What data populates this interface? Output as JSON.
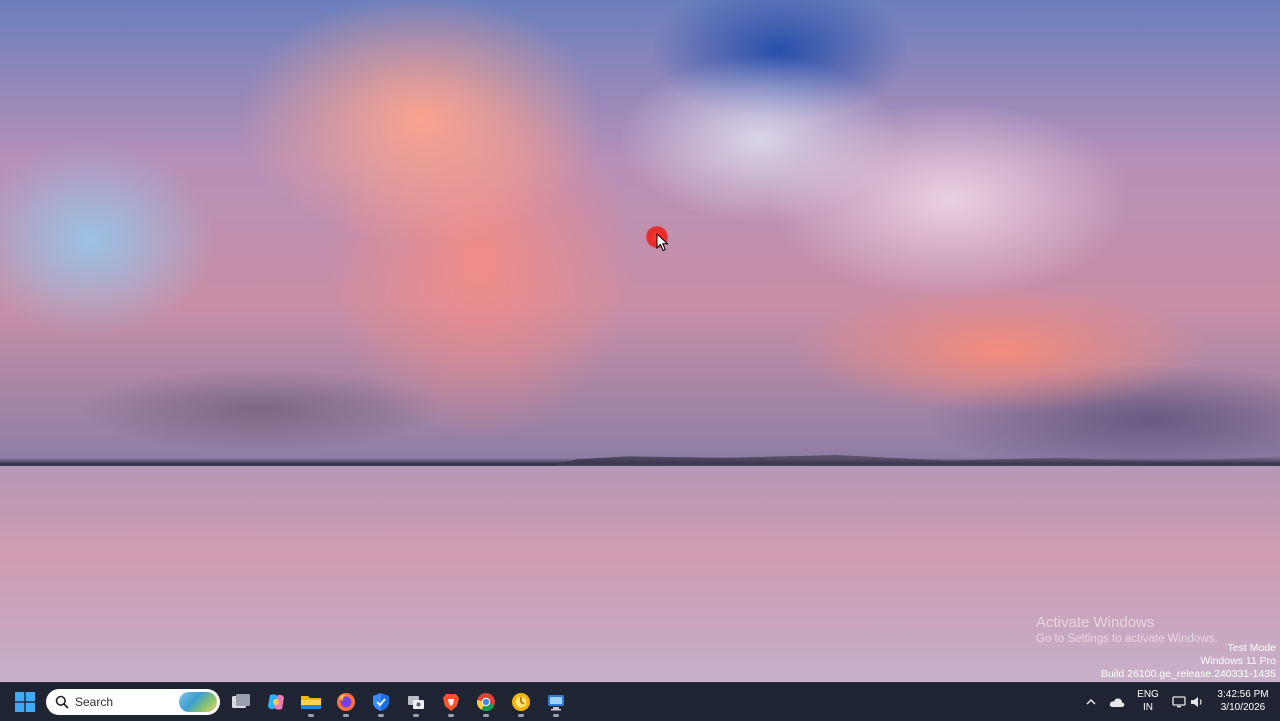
{
  "watermark": {
    "activate_title": "Activate Windows",
    "activate_sub": "Go to Settings to activate Windows."
  },
  "build_info": {
    "line1": "Test Mode",
    "line2": "Windows 11 Pro",
    "line3": "Build 26100.ge_release.240331-1435"
  },
  "taskbar": {
    "search_placeholder": "Search",
    "apps": [
      {
        "icon": "task-view-icon"
      },
      {
        "icon": "copilot-icon"
      },
      {
        "icon": "file-explorer-icon"
      },
      {
        "icon": "firefox-icon"
      },
      {
        "icon": "security-shield-icon"
      },
      {
        "icon": "remote-desktop-icon"
      },
      {
        "icon": "brave-icon"
      },
      {
        "icon": "chrome-icon"
      },
      {
        "icon": "yellow-app-icon"
      },
      {
        "icon": "network-app-icon"
      }
    ],
    "tray": {
      "lang_top": "ENG",
      "lang_bottom": "IN",
      "time": "3:42:56 PM",
      "date": "3/10/2026"
    }
  }
}
